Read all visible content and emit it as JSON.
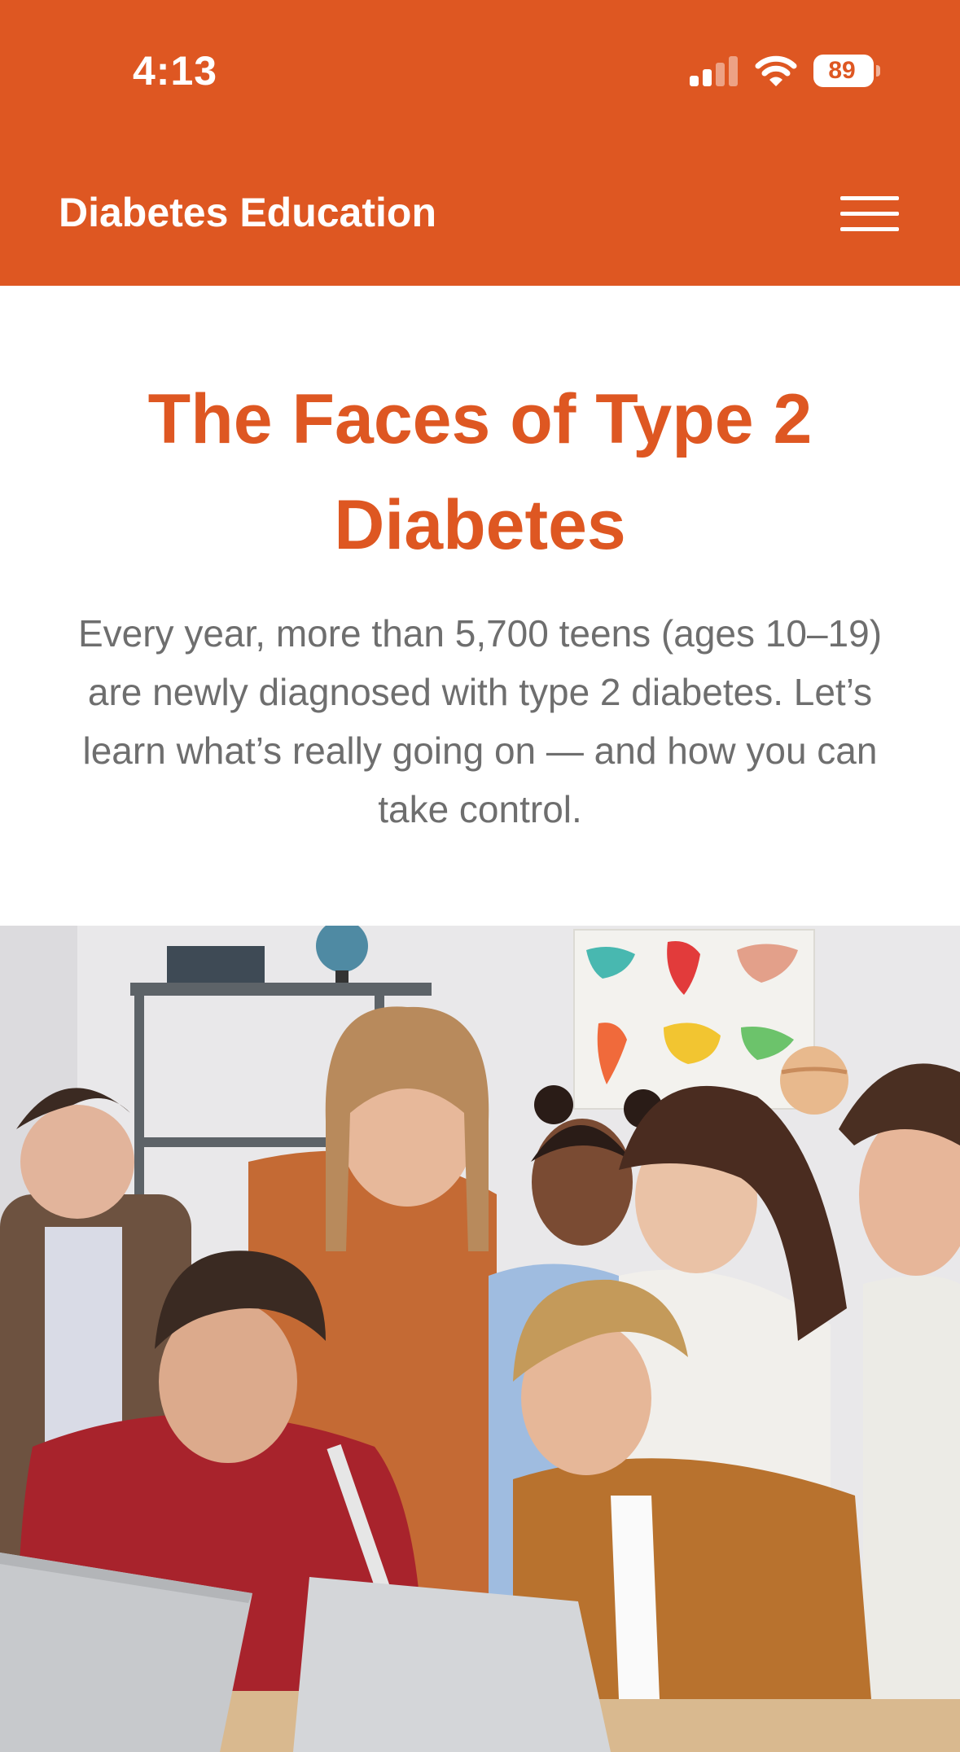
{
  "status_bar": {
    "time": "4:13",
    "battery": "89",
    "icons": [
      "cellular-signal-icon",
      "wifi-icon",
      "battery-icon"
    ]
  },
  "header": {
    "title": "Diabetes Education",
    "menu_icon": "hamburger-menu-icon"
  },
  "hero": {
    "title": "The Faces of Type 2 Diabetes",
    "description": "Every year, more than 5,700 teens (ages 10–19) are newly diagnosed with type 2 diabetes. Let’s learn what’s really going on — and how you can take control."
  },
  "colors": {
    "brand": "#DE5722",
    "body_text": "#6E6E6E",
    "background": "#FFFFFF"
  }
}
